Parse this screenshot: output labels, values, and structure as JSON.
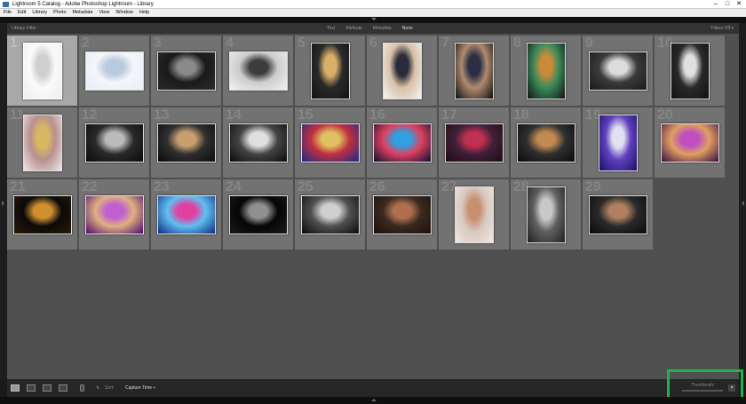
{
  "window": {
    "title": "Lightroom 5 Catalog - Adobe Photoshop Lightroom - Library",
    "controls": [
      "–",
      "□",
      "✕"
    ]
  },
  "menu": [
    "File",
    "Edit",
    "Library",
    "Photo",
    "Metadata",
    "View",
    "Window",
    "Help"
  ],
  "filter_bar": {
    "title": "Library Filter :",
    "options": [
      "Text",
      "Attribute",
      "Metadata",
      "None"
    ],
    "active": "None",
    "preset": "Filters Off ▾"
  },
  "photos": [
    {
      "num": "1",
      "selected": true,
      "orientation": "portrait",
      "colors": [
        "#eeeeee",
        "#cfcfcf",
        "#fafafa"
      ]
    },
    {
      "num": "2",
      "orientation": "landscape",
      "colors": [
        "#e8eef7",
        "#b9c9de",
        "#f4f6fa"
      ]
    },
    {
      "num": "3",
      "orientation": "landscape",
      "colors": [
        "#2b2b2b",
        "#8a8a8a",
        "#1a1a1a"
      ]
    },
    {
      "num": "4",
      "orientation": "landscape",
      "colors": [
        "#f2f2f2",
        "#3c3c3c",
        "#cccccc"
      ]
    },
    {
      "num": "5",
      "orientation": "portrait",
      "colors": [
        "#121212",
        "#d8b06a",
        "#2a2a2a"
      ]
    },
    {
      "num": "6",
      "orientation": "portrait",
      "colors": [
        "#f4f4f4",
        "#2a2a3a",
        "#d9c0a8"
      ]
    },
    {
      "num": "7",
      "orientation": "portrait",
      "colors": [
        "#0d0d0d",
        "#2b2f44",
        "#b08a70"
      ]
    },
    {
      "num": "8",
      "orientation": "portrait",
      "colors": [
        "#111111",
        "#c98a3a",
        "#3a8a5a"
      ]
    },
    {
      "num": "9",
      "orientation": "landscape",
      "colors": [
        "#1a1a1a",
        "#dcdcdc",
        "#3a3a3a"
      ]
    },
    {
      "num": "10",
      "orientation": "portrait",
      "colors": [
        "#101010",
        "#e0e0e0",
        "#2a2a2a"
      ]
    },
    {
      "num": "11",
      "orientation": "portrait",
      "colors": [
        "#f0e6e6",
        "#d8b860",
        "#b89090"
      ]
    },
    {
      "num": "12",
      "orientation": "landscape",
      "colors": [
        "#0a0a0a",
        "#bbbbbb",
        "#2a2a2a"
      ]
    },
    {
      "num": "13",
      "orientation": "landscape",
      "colors": [
        "#0a0a0a",
        "#c8a070",
        "#303030"
      ]
    },
    {
      "num": "14",
      "orientation": "landscape",
      "colors": [
        "#0a0a0a",
        "#e0e0e0",
        "#444444"
      ]
    },
    {
      "num": "15",
      "orientation": "landscape",
      "colors": [
        "#1a2a8a",
        "#e0c060",
        "#c03040"
      ]
    },
    {
      "num": "16",
      "orientation": "landscape",
      "colors": [
        "#0a1030",
        "#30a0e0",
        "#e04060"
      ]
    },
    {
      "num": "17",
      "orientation": "landscape",
      "colors": [
        "#200a10",
        "#c03050",
        "#40203a"
      ]
    },
    {
      "num": "18",
      "orientation": "landscape",
      "colors": [
        "#0a0a0a",
        "#c08a50",
        "#303030"
      ]
    },
    {
      "num": "19",
      "orientation": "portrait",
      "colors": [
        "#1a1060",
        "#e0e0f0",
        "#6040c0"
      ]
    },
    {
      "num": "20",
      "orientation": "landscape",
      "colors": [
        "#3a0a4a",
        "#c050c0",
        "#e0a060"
      ]
    },
    {
      "num": "21",
      "orientation": "landscape",
      "colors": [
        "#2a1a05",
        "#d09030",
        "#0a0a0a"
      ]
    },
    {
      "num": "22",
      "orientation": "landscape",
      "colors": [
        "#4a0a70",
        "#c060d0",
        "#e0b080"
      ]
    },
    {
      "num": "23",
      "orientation": "landscape",
      "colors": [
        "#102a80",
        "#e040a0",
        "#60c0f0"
      ]
    },
    {
      "num": "24",
      "orientation": "landscape",
      "colors": [
        "#1a1a1a",
        "#909090",
        "#050505"
      ]
    },
    {
      "num": "25",
      "orientation": "landscape",
      "colors": [
        "#0a0a0a",
        "#d0d0d0",
        "#505050"
      ]
    },
    {
      "num": "26",
      "orientation": "landscape",
      "colors": [
        "#1a0f0a",
        "#b07050",
        "#3a2a20"
      ]
    },
    {
      "num": "27",
      "orientation": "portrait",
      "colors": [
        "#f0e6e0",
        "#c89070",
        "#d8c8c0"
      ]
    },
    {
      "num": "28",
      "orientation": "portrait",
      "colors": [
        "#202020",
        "#c8c8c8",
        "#606060"
      ]
    },
    {
      "num": "29",
      "orientation": "landscape",
      "colors": [
        "#0a0a0a",
        "#b08060",
        "#2a2a2a"
      ]
    }
  ],
  "toolbar": {
    "view_modes": [
      "grid-view-icon",
      "loupe-view-icon",
      "compare-view-icon",
      "survey-view-icon"
    ],
    "active_view": "grid-view-icon",
    "sort_label": "Sort:",
    "sort_value": "Capture Time ÷",
    "thumbnails_label": "Thumbnails",
    "thumbnail_size": 0.7,
    "dropdown": "▾"
  }
}
